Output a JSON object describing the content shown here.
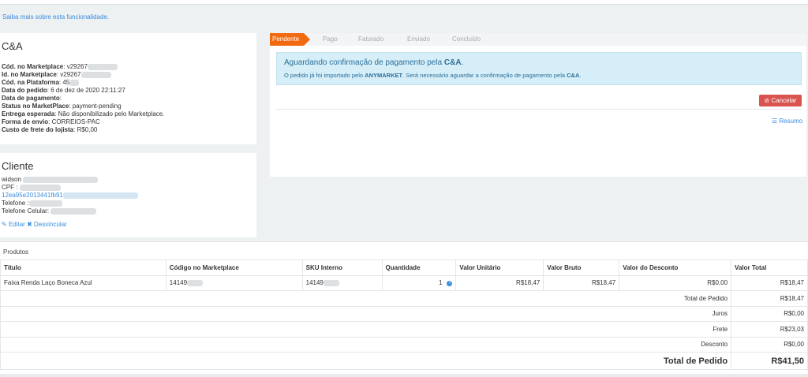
{
  "learn_more": "Saiba mais sobre esta funcionalidade.",
  "store": {
    "title": "C&A",
    "fields": [
      {
        "label": "Cód. no Marketplace",
        "value": ": v29267"
      },
      {
        "label": "Id. no Marketplace",
        "value": ": v29267"
      },
      {
        "label": "Cód. na Plataforma",
        "value": ": 45"
      },
      {
        "label": "Data do pedido",
        "value": ": 6 de dez de 2020 22:11:27"
      },
      {
        "label": "Data de pagamento",
        "value": ":"
      },
      {
        "label": "Status no MarketPlace",
        "value": ": payment-pending"
      },
      {
        "label": "Entrega esperada",
        "value": ": Não disponibilizado pelo Marketplace."
      },
      {
        "label": "Forma de envio",
        "value": ": CORREIOS-PAC"
      },
      {
        "label": "Custo de frete do lojista",
        "value": ": R$0,00"
      }
    ]
  },
  "client": {
    "title": "Cliente",
    "name": "widson",
    "cpf_label": "CPF :",
    "email": "12ea95e2013441fb91",
    "phone_label": "Telefone :",
    "mobile_label": "Telefone Celular:",
    "edit_label": "Editar",
    "unlink_label": "Desvincular"
  },
  "steps": [
    "Pendente",
    "Pago",
    "Faturado",
    "Enviado",
    "Concluído"
  ],
  "alert": {
    "title_prefix": "Aguardando confirmação de pagamento pela ",
    "title_store": "C&A",
    "title_suffix": ".",
    "text_prefix": "O pedido já foi importado pelo ",
    "text_brand": "ANYMARKET",
    "text_mid": ". Será necessário aguardar a confirmação de pagamento pela ",
    "text_store": "C&A",
    "text_suffix": "."
  },
  "cancel_label": "Cancelar",
  "summary_label": "Resumo",
  "products": {
    "heading": "Produtos",
    "columns": [
      "Título",
      "Código no Marketplace",
      "SKU Interno",
      "Quantidade",
      "Valor Unitário",
      "Valor Bruto",
      "Valor do Desconto",
      "Valor Total"
    ],
    "row": {
      "title": "Faixa Renda Laço Boneca Azul",
      "mkt_code": "14149",
      "sku": "14149",
      "qty": "1",
      "unit": "R$18,47",
      "gross": "R$18,47",
      "discount": "R$0,00",
      "total": "R$18,47"
    },
    "summary": [
      {
        "label": "Total de Pedido",
        "value": "R$18,47"
      },
      {
        "label": "Juros",
        "value": "R$0,00"
      },
      {
        "label": "Frete",
        "value": "R$23,03"
      },
      {
        "label": "Desconto",
        "value": "R$0,00"
      }
    ],
    "grand_total_label": "Total de Pedido",
    "grand_total_value": "R$41,50"
  },
  "colors": {
    "accent": "#f26a10",
    "danger": "#d9534f",
    "link": "#3a8dde",
    "info_bg": "#d6eef7"
  }
}
